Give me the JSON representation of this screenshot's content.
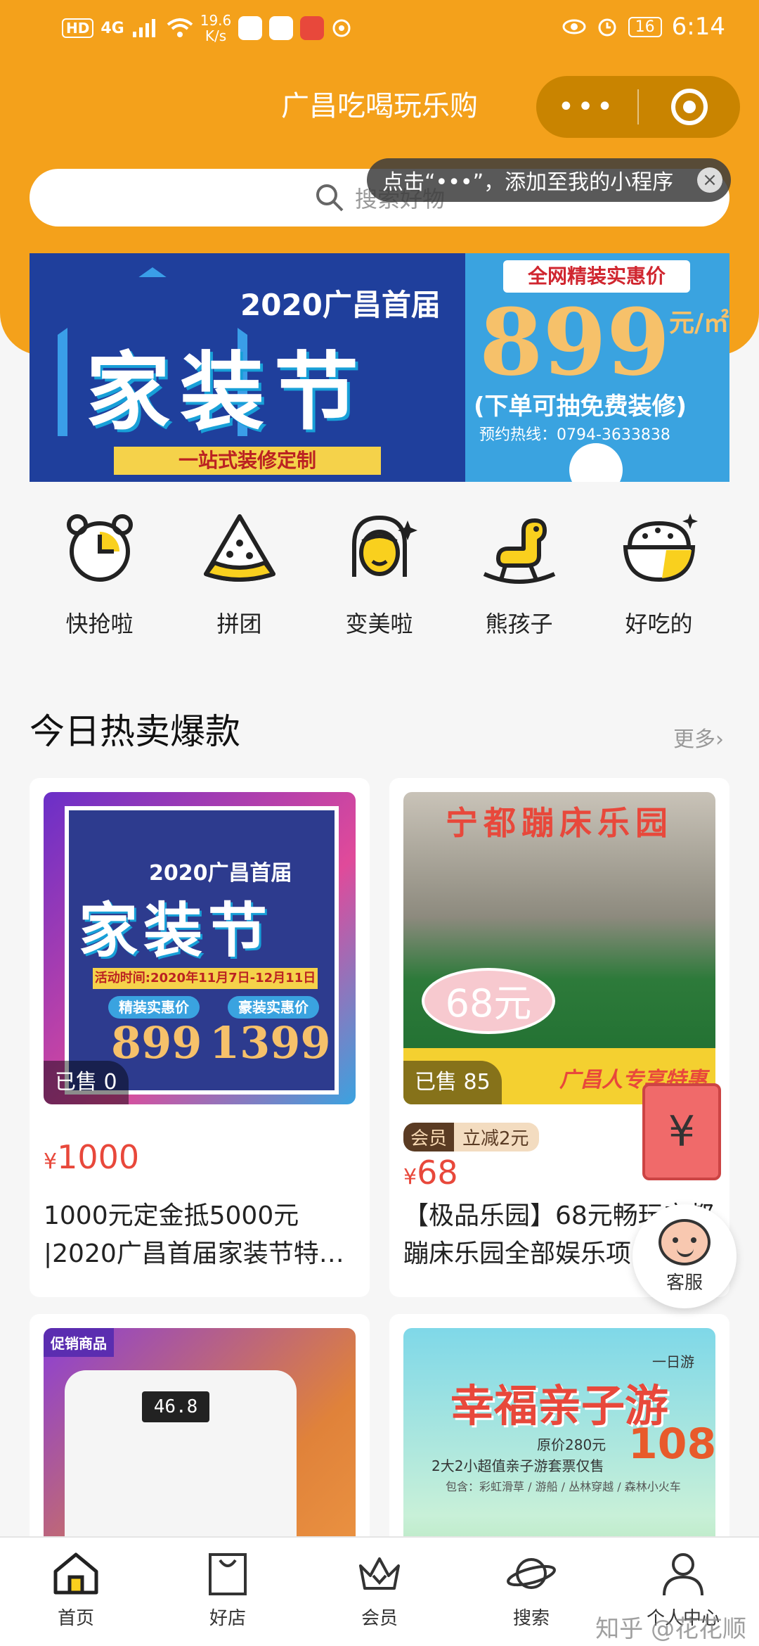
{
  "status_bar": {
    "network": "HD",
    "signal": "4G",
    "speed": "19.6",
    "speed_unit": "K/s",
    "battery": "16",
    "time": "6:14"
  },
  "app": {
    "title": "广昌吃喝玩乐购",
    "capsule_more": "•••",
    "tooltip": "点击“•••”，添加至我的小程序",
    "tooltip_close": "×"
  },
  "search": {
    "placeholder": "搜索好物"
  },
  "banner": {
    "year_line": "2020广昌首届",
    "main_title": "家装节",
    "tagline": "一站式装修定制",
    "subtitle": "全网精装实惠价",
    "price": "899",
    "price_unit": "元/㎡",
    "note": "(下单可抽免费装修)",
    "hotline": "预约热线：0794-3633838"
  },
  "categories": [
    {
      "label": "快抢啦",
      "icon": "alarm-clock-icon"
    },
    {
      "label": "拼团",
      "icon": "pizza-slice-icon"
    },
    {
      "label": "变美啦",
      "icon": "woman-face-icon"
    },
    {
      "label": "熊孩子",
      "icon": "rocking-horse-icon"
    },
    {
      "label": "好吃的",
      "icon": "rice-bowl-icon"
    }
  ],
  "section": {
    "title": "今日热卖爆款",
    "more": "更多›"
  },
  "products": [
    {
      "sold": "已售 0",
      "currency": "¥",
      "price": "1000",
      "title": "1000元定金抵5000元 |2020广昌首届家装节特惠...",
      "image": {
        "year_line": "2020广昌首届",
        "main_title": "家装节",
        "date": "活动时间:2020年11月7日-12月11日",
        "label_a": "精装实惠价",
        "label_b": "豪装实惠价",
        "num_a": "899",
        "num_b": "1399"
      }
    },
    {
      "sold": "已售 85",
      "member_tag": "会员",
      "discount_tag": "立减2元",
      "currency": "¥",
      "price": "68",
      "title": "【极品乐园】68元畅玩宁都蹦床乐园全部娱乐项目",
      "image": {
        "title": "宁都蹦床乐园",
        "bubble": "68元",
        "slogan": "广昌人专享特惠"
      }
    },
    {
      "image": {
        "badge": "促销商品",
        "display": "46.8"
      }
    },
    {
      "image": {
        "tag": "一日游",
        "title": "幸福亲子游",
        "orig_price": "原价280元",
        "price": "108",
        "desc": "2大2小超值亲子游套票仅售",
        "sub": "包含：彩虹滑草 / 游船 / 丛林穿越 / 森林小火车"
      }
    }
  ],
  "float": {
    "redpacket": "¥",
    "service": "客服"
  },
  "nav": [
    {
      "label": "首页",
      "icon": "home-icon"
    },
    {
      "label": "好店",
      "icon": "shopping-bag-icon"
    },
    {
      "label": "会员",
      "icon": "crown-icon"
    },
    {
      "label": "搜索",
      "icon": "planet-icon"
    },
    {
      "label": "个人中心",
      "icon": "person-icon"
    }
  ],
  "watermark": "知乎 @花花顺"
}
